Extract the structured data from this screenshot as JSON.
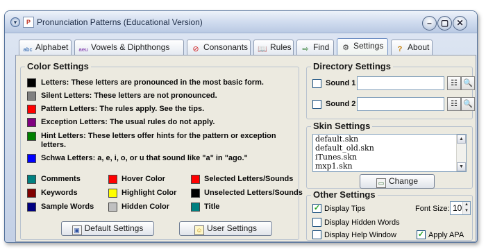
{
  "window": {
    "title": "Pronunciation Patterns (Educational Version)",
    "controls": {
      "minimize": "–",
      "maximize": "▢",
      "close": "✕"
    }
  },
  "tabs": [
    {
      "label": "Alphabet",
      "icon": "alphabet-icon",
      "glyph": "abc"
    },
    {
      "label": "Vowels & Diphthongs",
      "icon": "vowels-icon",
      "glyph": "aeu"
    },
    {
      "label": "Consonants",
      "icon": "consonants-icon",
      "glyph": "⊘"
    },
    {
      "label": "Rules",
      "icon": "book-icon",
      "glyph": "📖"
    },
    {
      "label": "Find",
      "icon": "find-icon",
      "glyph": "⇨"
    },
    {
      "label": "Settings",
      "icon": "settings-icon",
      "glyph": "⚙",
      "active": true
    },
    {
      "label": "About",
      "icon": "help-icon",
      "glyph": "?"
    }
  ],
  "color_settings": {
    "title": "Color Settings",
    "rows": [
      {
        "text": "Letters: These letters are pronounced in the most basic form.",
        "color": "#000000"
      },
      {
        "text": "Silent Letters: These letters are not pronounced.",
        "color": "#808080"
      },
      {
        "text": "Pattern Letters: The rules apply. See the tips.",
        "color": "#ff0000"
      },
      {
        "text": "Exception Letters: The usual rules do not apply.",
        "color": "#800080"
      },
      {
        "text": "Hint Letters: These letters offer hints for the pattern or exception",
        "text2": "letters.",
        "color": "#008000"
      },
      {
        "text": "Schwa Letters: a, e, i, o, or u that sound like \"a\" in \"ago.\"",
        "color": "#0000ff"
      }
    ],
    "grid": [
      {
        "label": "Comments",
        "color": "#008080"
      },
      {
        "label": "Hover Color",
        "color": "#ff0000"
      },
      {
        "label": "Selected Letters/Sounds",
        "color": "#ff0000"
      },
      {
        "label": "Keywords",
        "color": "#800000"
      },
      {
        "label": "Highlight Color",
        "color": "#ffff00"
      },
      {
        "label": "Unselected Letters/Sounds",
        "color": "#000000"
      },
      {
        "label": "Sample Words",
        "color": "#000080"
      },
      {
        "label": "Hidden Color",
        "color": "#c0c0c0"
      },
      {
        "label": "Title",
        "color": "#008080"
      }
    ],
    "default_button": "Default Settings",
    "user_button": "User Settings"
  },
  "directory_settings": {
    "title": "Directory Settings",
    "sound1": {
      "label": "Sound 1",
      "value": "",
      "checked": false
    },
    "sound2": {
      "label": "Sound 2",
      "value": "",
      "checked": false
    }
  },
  "skin_settings": {
    "title": "Skin Settings",
    "items": [
      "default.skn",
      "default_old.skn",
      "iTunes.skn",
      "mxp1.skn"
    ],
    "change_button": "Change"
  },
  "other_settings": {
    "title": "Other Settings",
    "display_tips": {
      "label": "Display Tips",
      "checked": true
    },
    "font_size_label": "Font Size:",
    "font_size": "10",
    "display_hidden_words": {
      "label": "Display Hidden Words",
      "checked": false
    },
    "display_help_window": {
      "label": "Display Help Window",
      "checked": false
    },
    "apply_apa": {
      "label": "Apply APA",
      "checked": true
    }
  }
}
